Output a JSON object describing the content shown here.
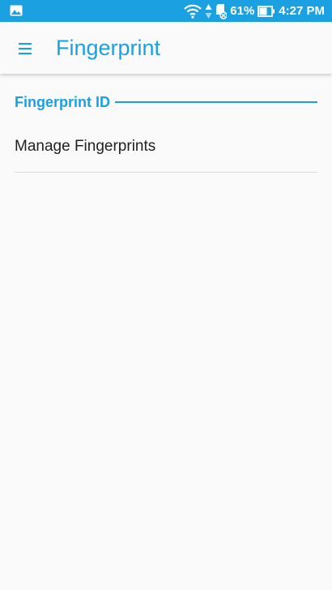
{
  "status_bar": {
    "battery_percent": "61%",
    "time": "4:27 PM",
    "icons": [
      "gallery-notification-icon",
      "wifi-icon",
      "data-arrows-icon",
      "sd-card-icon",
      "battery-icon"
    ]
  },
  "app_bar": {
    "menu_icon": "hamburger-menu-icon",
    "title": "Fingerprint"
  },
  "section": {
    "title": "Fingerprint ID"
  },
  "items": [
    {
      "label": "Manage Fingerprints"
    }
  ],
  "colors": {
    "accent": "#1ba1e2",
    "background": "#fafafa",
    "text": "#212121",
    "divider": "#d9d9d9"
  }
}
